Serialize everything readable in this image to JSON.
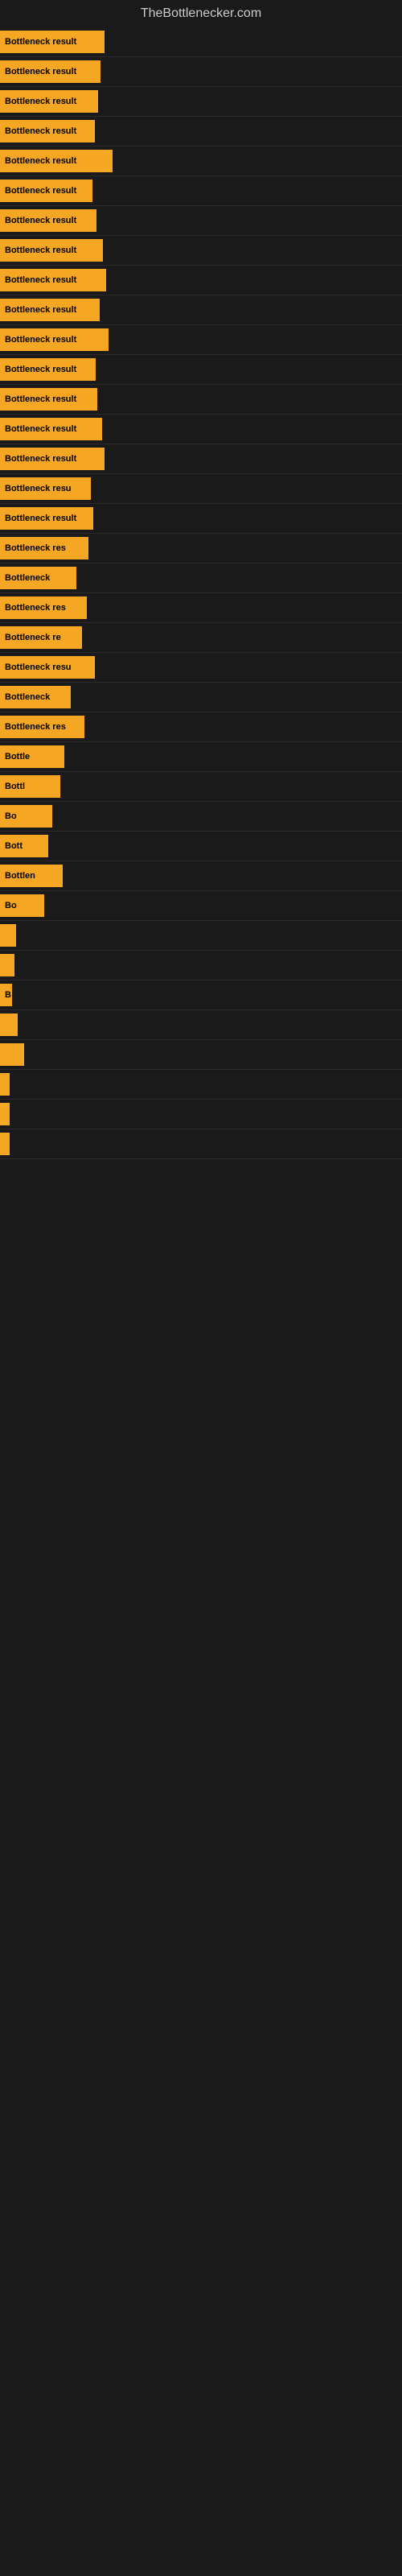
{
  "site": {
    "title": "TheBottlenecker.com"
  },
  "items": [
    {
      "id": 0,
      "label": "Bottleneck result"
    },
    {
      "id": 1,
      "label": "Bottleneck result"
    },
    {
      "id": 2,
      "label": "Bottleneck result"
    },
    {
      "id": 3,
      "label": "Bottleneck result"
    },
    {
      "id": 4,
      "label": "Bottleneck result"
    },
    {
      "id": 5,
      "label": "Bottleneck result"
    },
    {
      "id": 6,
      "label": "Bottleneck result"
    },
    {
      "id": 7,
      "label": "Bottleneck result"
    },
    {
      "id": 8,
      "label": "Bottleneck result"
    },
    {
      "id": 9,
      "label": "Bottleneck result"
    },
    {
      "id": 10,
      "label": "Bottleneck result"
    },
    {
      "id": 11,
      "label": "Bottleneck result"
    },
    {
      "id": 12,
      "label": "Bottleneck result"
    },
    {
      "id": 13,
      "label": "Bottleneck result"
    },
    {
      "id": 14,
      "label": "Bottleneck result"
    },
    {
      "id": 15,
      "label": "Bottleneck resu"
    },
    {
      "id": 16,
      "label": "Bottleneck result"
    },
    {
      "id": 17,
      "label": "Bottleneck res"
    },
    {
      "id": 18,
      "label": "Bottleneck"
    },
    {
      "id": 19,
      "label": "Bottleneck res"
    },
    {
      "id": 20,
      "label": "Bottleneck re"
    },
    {
      "id": 21,
      "label": "Bottleneck resu"
    },
    {
      "id": 22,
      "label": "Bottleneck"
    },
    {
      "id": 23,
      "label": "Bottleneck res"
    },
    {
      "id": 24,
      "label": "Bottle"
    },
    {
      "id": 25,
      "label": "Bottl"
    },
    {
      "id": 26,
      "label": "Bo"
    },
    {
      "id": 27,
      "label": "Bott"
    },
    {
      "id": 28,
      "label": "Bottlen"
    },
    {
      "id": 29,
      "label": "Bo"
    },
    {
      "id": 30,
      "label": ""
    },
    {
      "id": 31,
      "label": ""
    },
    {
      "id": 32,
      "label": "B"
    },
    {
      "id": 33,
      "label": ""
    },
    {
      "id": 34,
      "label": ""
    },
    {
      "id": 35,
      "label": ""
    },
    {
      "id": 36,
      "label": ""
    },
    {
      "id": 37,
      "label": ""
    }
  ]
}
